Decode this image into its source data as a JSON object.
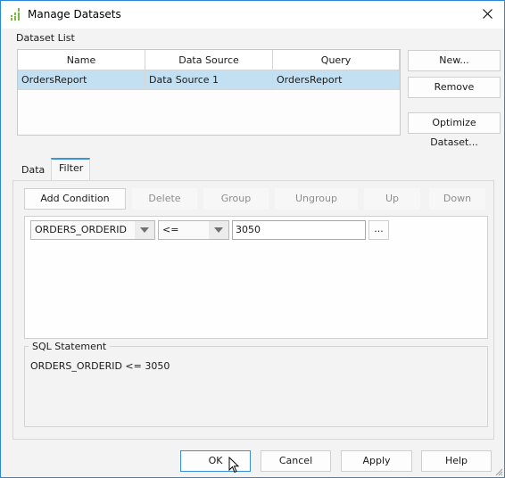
{
  "window": {
    "title": "Manage Datasets",
    "icon": "bar-chart-icon",
    "close_icon": "close-icon"
  },
  "dataset_list": {
    "label": "Dataset List",
    "columns": [
      "Name",
      "Data Source",
      "Query"
    ],
    "rows": [
      {
        "name": "OrdersReport",
        "data_source": "Data Source 1",
        "query": "OrdersReport",
        "selected": true
      }
    ],
    "buttons": {
      "new": "New...",
      "remove": "Remove",
      "optimize": "Optimize Dataset..."
    }
  },
  "tabs": [
    {
      "label": "Data",
      "active": false
    },
    {
      "label": "Filter",
      "active": true
    }
  ],
  "filter": {
    "toolbar": {
      "add_condition": "Add Condition",
      "delete": "Delete",
      "group": "Group",
      "ungroup": "Ungroup",
      "up": "Up",
      "down": "Down"
    },
    "condition": {
      "field": "ORDERS_ORDERID",
      "operator": "<=",
      "value": "3050",
      "ellipsis_label": "..."
    },
    "sql_label": "SQL Statement",
    "sql_text": "ORDERS_ORDERID <= 3050"
  },
  "footer": {
    "ok": "OK",
    "cancel": "Cancel",
    "apply": "Apply",
    "help": "Help"
  },
  "colors": {
    "accent": "#2b87d8",
    "selection": "#c3e0f3"
  }
}
